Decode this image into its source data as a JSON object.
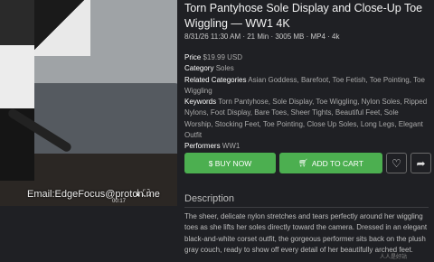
{
  "video": {
    "watermark": "Email:EdgeFocus@proton.me",
    "time": "00:17"
  },
  "product": {
    "title": "Torn Pantyhose Sole Display and Close-Up Toe Wiggling — WW1 4K",
    "meta": "8/31/26 11:30 AM  ·  21 Min  ·  3005 MB  ·  MP4  ·  4k",
    "price_label": "Price",
    "price_value": "$19.99 USD",
    "category_label": "Category",
    "category_value": "Soles",
    "related_label": "Related Categories",
    "related_value": "Asian Goddess, Barefoot, Toe Fetish, Toe Pointing, Toe Wiggling",
    "keywords_label": "Keywords",
    "keywords_value": "Torn Pantyhose, Sole Display, Toe Wiggling, Nylon Soles, Ripped Nylons, Foot Display, Bare Toes, Sheer Tights, Beautiful Feet, Sole Worship, Stocking Feet, Toe Pointing, Close Up Soles, Long Legs, Elegant Outfit",
    "performers_label": "Performers",
    "performers_value": "WW1"
  },
  "actions": {
    "buy_label": "$ BUY NOW",
    "cart_label": "ADD TO CART"
  },
  "description": {
    "heading": "Description",
    "text": "The sheer, delicate nylon stretches and tears perfectly around her wiggling toes as she lifts her soles directly toward the camera. Dressed in an elegant black-and-white corset outfit, the gorgeous performer sits back on the plush gray couch, ready to show off every detail of her beautifully arched feet."
  },
  "corner_text": "人人是好站",
  "colors": {
    "accent": "#4caf50",
    "background": "#1f2024"
  }
}
